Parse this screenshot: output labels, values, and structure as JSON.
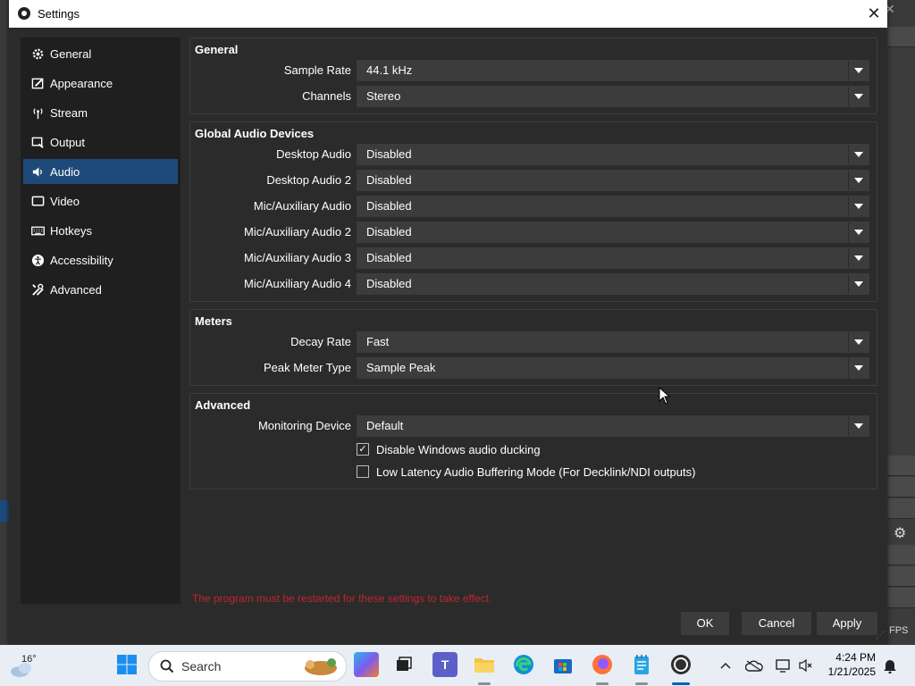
{
  "window": {
    "title": "Settings"
  },
  "sidebar": {
    "items": [
      {
        "label": "General",
        "icon": "gear-icon"
      },
      {
        "label": "Appearance",
        "icon": "paint-icon"
      },
      {
        "label": "Stream",
        "icon": "broadcast-icon"
      },
      {
        "label": "Output",
        "icon": "output-icon"
      },
      {
        "label": "Audio",
        "icon": "speaker-icon",
        "active": true
      },
      {
        "label": "Video",
        "icon": "monitor-icon"
      },
      {
        "label": "Hotkeys",
        "icon": "keyboard-icon"
      },
      {
        "label": "Accessibility",
        "icon": "accessibility-icon"
      },
      {
        "label": "Advanced",
        "icon": "tools-icon"
      }
    ]
  },
  "general": {
    "title": "General",
    "sample_rate": {
      "label": "Sample Rate",
      "value": "44.1 kHz"
    },
    "channels": {
      "label": "Channels",
      "value": "Stereo"
    }
  },
  "global_audio": {
    "title": "Global Audio Devices",
    "rows": [
      {
        "label": "Desktop Audio",
        "value": "Disabled"
      },
      {
        "label": "Desktop Audio 2",
        "value": "Disabled"
      },
      {
        "label": "Mic/Auxiliary Audio",
        "value": "Disabled"
      },
      {
        "label": "Mic/Auxiliary Audio 2",
        "value": "Disabled"
      },
      {
        "label": "Mic/Auxiliary Audio 3",
        "value": "Disabled"
      },
      {
        "label": "Mic/Auxiliary Audio 4",
        "value": "Disabled"
      }
    ]
  },
  "meters": {
    "title": "Meters",
    "decay_rate": {
      "label": "Decay Rate",
      "value": "Fast"
    },
    "peak_meter_type": {
      "label": "Peak Meter Type",
      "value": "Sample Peak"
    }
  },
  "advanced": {
    "title": "Advanced",
    "monitoring_device": {
      "label": "Monitoring Device",
      "value": "Default"
    },
    "disable_ducking": {
      "label": "Disable Windows audio ducking",
      "checked": true,
      "mark": "✓"
    },
    "low_latency": {
      "label": "Low Latency Audio Buffering Mode (For Decklink/NDI outputs)",
      "checked": false
    }
  },
  "warning": "The program must be restarted for these settings to take effect.",
  "buttons": {
    "ok": "OK",
    "cancel": "Cancel",
    "apply": "Apply"
  },
  "background_app": {
    "fps_label": "FPS"
  },
  "taskbar": {
    "weather_temp": "16°",
    "search_placeholder": "Search",
    "time": "4:24 PM",
    "date": "1/21/2025"
  },
  "colors": {
    "accent": "#1e4a7a",
    "warning": "#c0262d",
    "panel": "#2b2b2b",
    "sidebar": "#1f1f1f",
    "combo": "#3c3c3c"
  }
}
